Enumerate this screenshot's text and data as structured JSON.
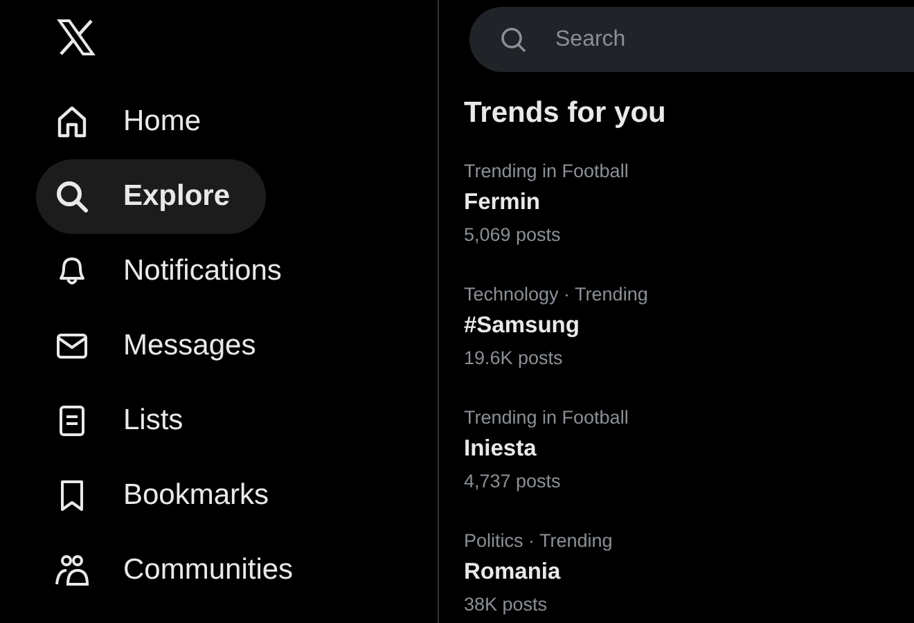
{
  "sidebar": {
    "items": [
      {
        "label": "Home",
        "kind": "home",
        "selected": false
      },
      {
        "label": "Explore",
        "kind": "search",
        "selected": true
      },
      {
        "label": "Notifications",
        "kind": "bell",
        "selected": false
      },
      {
        "label": "Messages",
        "kind": "mail",
        "selected": false
      },
      {
        "label": "Lists",
        "kind": "list",
        "selected": false
      },
      {
        "label": "Bookmarks",
        "kind": "bookmark",
        "selected": false
      },
      {
        "label": "Communities",
        "kind": "people",
        "selected": false
      }
    ]
  },
  "search": {
    "placeholder": "Search"
  },
  "trends": {
    "title": "Trends for you",
    "items": [
      {
        "context": "Trending in Football",
        "name": "Fermin",
        "posts": "5,069 posts"
      },
      {
        "context": "Technology · Trending",
        "name": "#Samsung",
        "posts": "19.6K posts"
      },
      {
        "context": "Trending in Football",
        "name": "Iniesta",
        "posts": "4,737 posts"
      },
      {
        "context": "Politics · Trending",
        "name": "Romania",
        "posts": "38K posts"
      }
    ]
  }
}
